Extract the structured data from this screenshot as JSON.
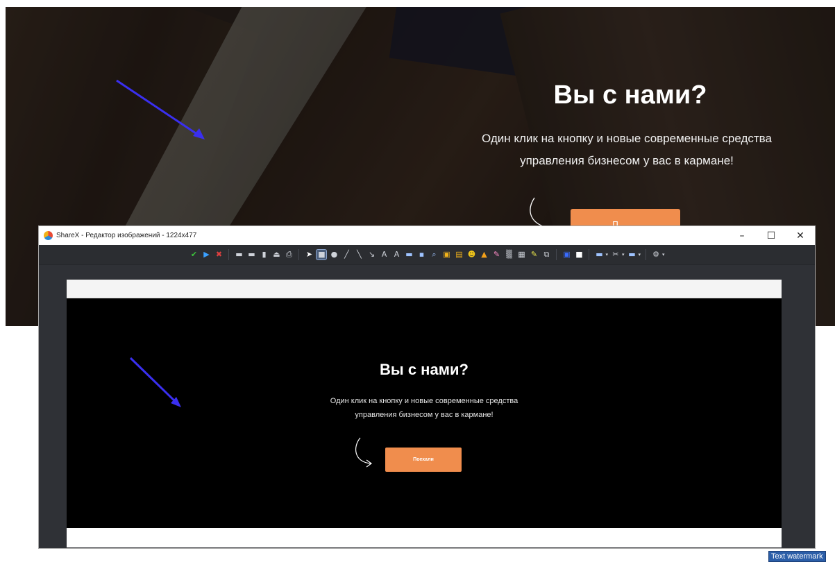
{
  "hero": {
    "title": "Вы с нами?",
    "text_line1": "Один клик на кнопку и новые современные средства",
    "text_line2": "управления бизнесом у вас в кармане!",
    "button_label": "П",
    "accent_color": "#f08d4d",
    "annotation_arrow_color": "#3a2ff0"
  },
  "window": {
    "title": "ShareX - Редактор изображений - 1224x477",
    "minimize_symbol": "–",
    "maximize_symbol": "☐",
    "close_symbol": "✕"
  },
  "toolbar": {
    "tools": [
      {
        "icon": "confirm-icon",
        "glyph": "✔",
        "color": "#3cc43c"
      },
      {
        "icon": "continue-icon",
        "glyph": "▶",
        "color": "#3aa0ff"
      },
      {
        "icon": "cancel-icon",
        "glyph": "✖",
        "color": "#e04040"
      },
      {
        "icon": "save-icon",
        "glyph": "▬",
        "color": "#cfd3da"
      },
      {
        "icon": "save-as-icon",
        "glyph": "▬",
        "color": "#cfd3da"
      },
      {
        "icon": "copy-icon",
        "glyph": "▮",
        "color": "#cfd3da"
      },
      {
        "icon": "upload-icon",
        "glyph": "⏏",
        "color": "#cfd3da"
      },
      {
        "icon": "print-icon",
        "glyph": "⎙",
        "color": "#cfd3da"
      },
      {
        "icon": "select-icon",
        "glyph": "➤",
        "color": "#ffffff"
      },
      {
        "icon": "rectangle-icon",
        "glyph": "■",
        "color": "#cfd3da"
      },
      {
        "icon": "ellipse-icon",
        "glyph": "●",
        "color": "#cfd3da"
      },
      {
        "icon": "freehand-icon",
        "glyph": "╱",
        "color": "#cfd3da"
      },
      {
        "icon": "line-icon",
        "glyph": "╲",
        "color": "#cfd3da"
      },
      {
        "icon": "arrow-icon",
        "glyph": "↘",
        "color": "#cfd3da"
      },
      {
        "icon": "text-outline-icon",
        "glyph": "A",
        "color": "#cfd3da"
      },
      {
        "icon": "text-background-icon",
        "glyph": "A",
        "color": "#cfd3da"
      },
      {
        "icon": "speech-balloon-icon",
        "glyph": "▬",
        "color": "#9ec3ff"
      },
      {
        "icon": "step-icon",
        "glyph": "▪",
        "color": "#9ec3ff"
      },
      {
        "icon": "magnify-icon",
        "glyph": "⌕",
        "color": "#9ec3ff"
      },
      {
        "icon": "image-file-icon",
        "glyph": "▣",
        "color": "#f2b31a"
      },
      {
        "icon": "image-screen-icon",
        "glyph": "▤",
        "color": "#f2b31a"
      },
      {
        "icon": "sticker-icon",
        "glyph": "☻",
        "color": "#f2c71a"
      },
      {
        "icon": "cursor-icon",
        "glyph": "▲",
        "color": "#f2a01a"
      },
      {
        "icon": "smart-eraser-icon",
        "glyph": "✎",
        "color": "#ff8cc8"
      },
      {
        "icon": "blur-icon",
        "glyph": "▒",
        "color": "#cfd3da"
      },
      {
        "icon": "pixelate-icon",
        "glyph": "▦",
        "color": "#cfd3da"
      },
      {
        "icon": "highlight-icon",
        "glyph": "✎",
        "color": "#e8e34a"
      },
      {
        "icon": "crop-icon",
        "glyph": "⧉",
        "color": "#cfd3da"
      }
    ],
    "tools2": [
      {
        "icon": "border-color-icon",
        "glyph": "▣",
        "color": "#3a6cff"
      },
      {
        "icon": "fill-color-icon",
        "glyph": "■",
        "color": "#ffffff"
      },
      {
        "icon": "image-options-icon",
        "glyph": "▬",
        "color": "#9ec3ff",
        "dropdown": "▾"
      },
      {
        "icon": "edit-options-icon",
        "glyph": "✂",
        "color": "#cfd3da",
        "dropdown": "▾"
      },
      {
        "icon": "capture-options-icon",
        "glyph": "▬",
        "color": "#9ec3ff",
        "dropdown": "▾"
      },
      {
        "icon": "settings-icon",
        "glyph": "⚙",
        "color": "#cfd3da",
        "dropdown": "▾"
      }
    ]
  },
  "canvas": {
    "title": "Вы с нами?",
    "text_line1": "Один клик на кнопку и новые современные средства",
    "text_line2": "управления бизнесом у вас в кармане!",
    "button_label": "Поехали"
  },
  "watermark": {
    "label": "Text watermark"
  }
}
